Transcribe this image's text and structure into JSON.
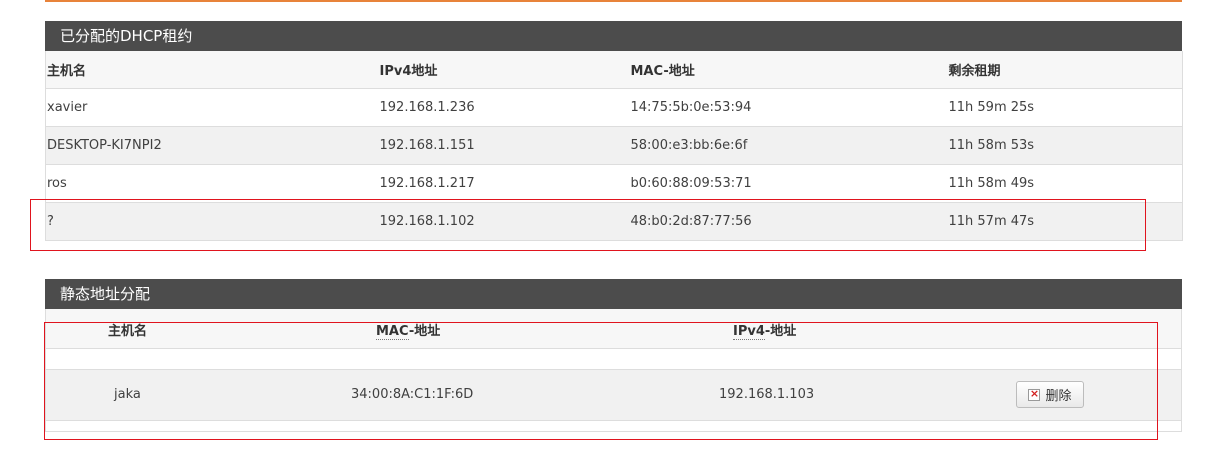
{
  "dhcp_leases": {
    "title": "已分配的DHCP租约",
    "columns": [
      "主机名",
      "IPv4地址",
      "MAC-地址",
      "剩余租期"
    ],
    "rows": [
      {
        "hostname": "xavier",
        "ipv4": "192.168.1.236",
        "mac": "14:75:5b:0e:53:94",
        "lease": "11h 59m 25s"
      },
      {
        "hostname": "DESKTOP-KI7NPI2",
        "ipv4": "192.168.1.151",
        "mac": "58:00:e3:bb:6e:6f",
        "lease": "11h 58m 53s"
      },
      {
        "hostname": "ros",
        "ipv4": "192.168.1.217",
        "mac": "b0:60:88:09:53:71",
        "lease": "11h 58m 49s"
      },
      {
        "hostname": "?",
        "ipv4": "192.168.1.102",
        "mac": "48:b0:2d:87:77:56",
        "lease": "11h 57m 47s"
      }
    ]
  },
  "static_leases": {
    "title": "静态地址分配",
    "columns": {
      "hostname": "主机名",
      "mac_abbr": "MAC",
      "mac_suffix": "-地址",
      "ipv4_abbr": "IPv4",
      "ipv4_suffix": "-地址"
    },
    "rows": [
      {
        "hostname": "jaka",
        "mac": "34:00:8A:C1:1F:6D",
        "ipv4": "192.168.1.103",
        "delete_label": "删除"
      }
    ]
  },
  "colors": {
    "accent": "#e8833a",
    "header_bg": "#4c4c4c",
    "highlight": "#e0141e"
  }
}
